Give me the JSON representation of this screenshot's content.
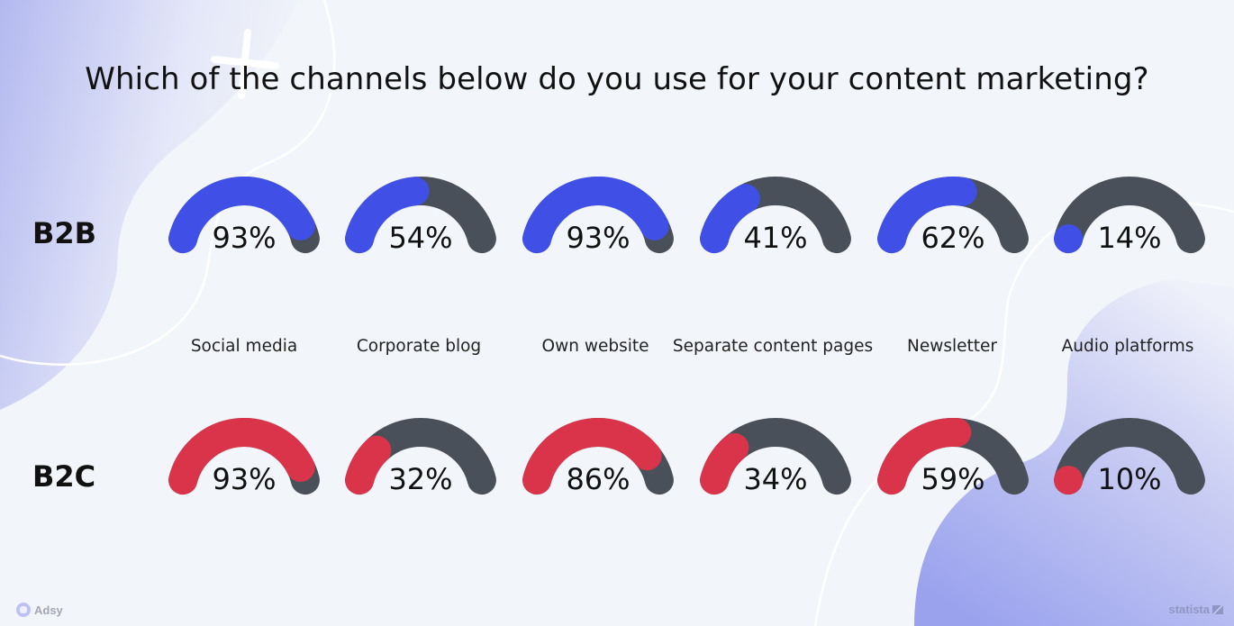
{
  "chart_data": {
    "type": "gauge",
    "title": "Which of the channels below do you use for your content marketing?",
    "categories": [
      "Social media",
      "Corporate blog",
      "Own website",
      "Separate content pages",
      "Newsletter",
      "Audio platforms"
    ],
    "series": [
      {
        "name": "B2B",
        "color": "#4050e6",
        "values": [
          93,
          54,
          93,
          41,
          62,
          14
        ]
      },
      {
        "name": "B2C",
        "color": "#d9344a",
        "values": [
          93,
          32,
          86,
          34,
          59,
          10
        ]
      }
    ],
    "unit": "%",
    "range": [
      0,
      100
    ],
    "track_color": "#4a5059"
  },
  "branding": {
    "left": "Adsy",
    "right": "statista"
  }
}
